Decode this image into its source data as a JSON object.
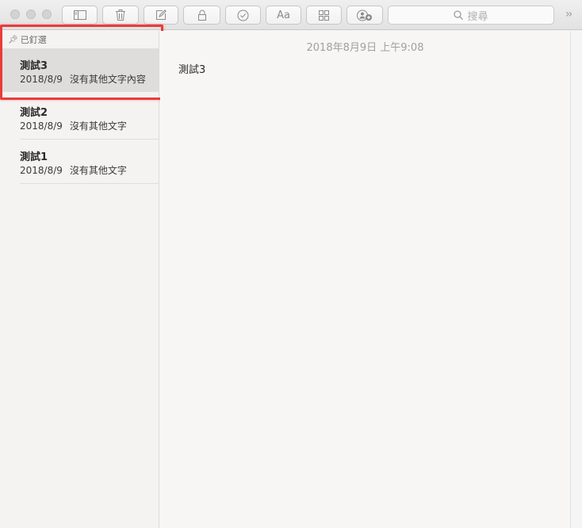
{
  "toolbar": {
    "search_placeholder": "搜尋",
    "overflow_label": "››",
    "buttons": [
      {
        "icon": "sidebar-toggle-icon"
      },
      {
        "icon": "trash-icon"
      },
      {
        "icon": "compose-icon"
      },
      {
        "icon": "lock-icon"
      },
      {
        "icon": "checklist-icon"
      },
      {
        "icon": "format-icon",
        "label": "Aa"
      },
      {
        "icon": "attachments-grid-icon"
      },
      {
        "icon": "add-people-icon"
      }
    ]
  },
  "sidebar": {
    "pinned_header": "已釘選",
    "notes": [
      {
        "title": "測試3",
        "date": "2018/8/9",
        "preview": "沒有其他文字內容",
        "selected": true
      },
      {
        "title": "測試2",
        "date": "2018/8/9",
        "preview": "沒有其他文字"
      },
      {
        "title": "測試1",
        "date": "2018/8/9",
        "preview": "沒有其他文字"
      }
    ]
  },
  "editor": {
    "timestamp": "2018年8月9日 上午9:08",
    "body": "測試3"
  },
  "colors": {
    "highlight": "#ea3b3b",
    "selected_row": "#dedddb"
  }
}
